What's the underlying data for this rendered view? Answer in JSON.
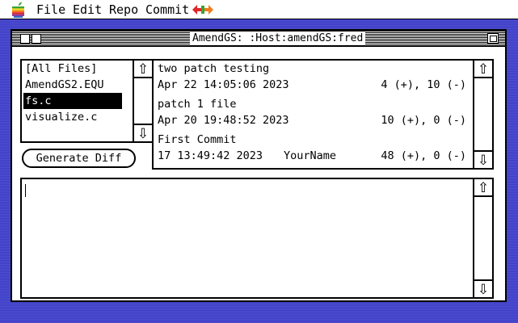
{
  "menubar": {
    "items": [
      "File",
      "Edit",
      "Repo",
      "Commit"
    ]
  },
  "window": {
    "title": "AmendGS: :Host:amendGS:fred"
  },
  "files": {
    "items": [
      "[All Files]",
      "AmendGS2.EQU",
      "fs.c",
      "visualize.c"
    ],
    "selected_index": 2
  },
  "generate_diff_label": "Generate Diff",
  "commits": [
    {
      "message": "two patch testing",
      "date": "Apr 22 14:05:06 2023",
      "author": "",
      "stats": "4 (+), 10 (-)"
    },
    {
      "message": "patch 1 file",
      "date": "Apr 20 19:48:52 2023",
      "author": "",
      "stats": "10 (+), 0 (-)"
    },
    {
      "message": "First Commit",
      "date": " 17 13:49:42 2023",
      "author": "YourName",
      "stats": "48 (+), 0 (-)"
    }
  ],
  "scroll_arrows": {
    "up": "⇧",
    "down": "⇩"
  },
  "diff_text": ""
}
